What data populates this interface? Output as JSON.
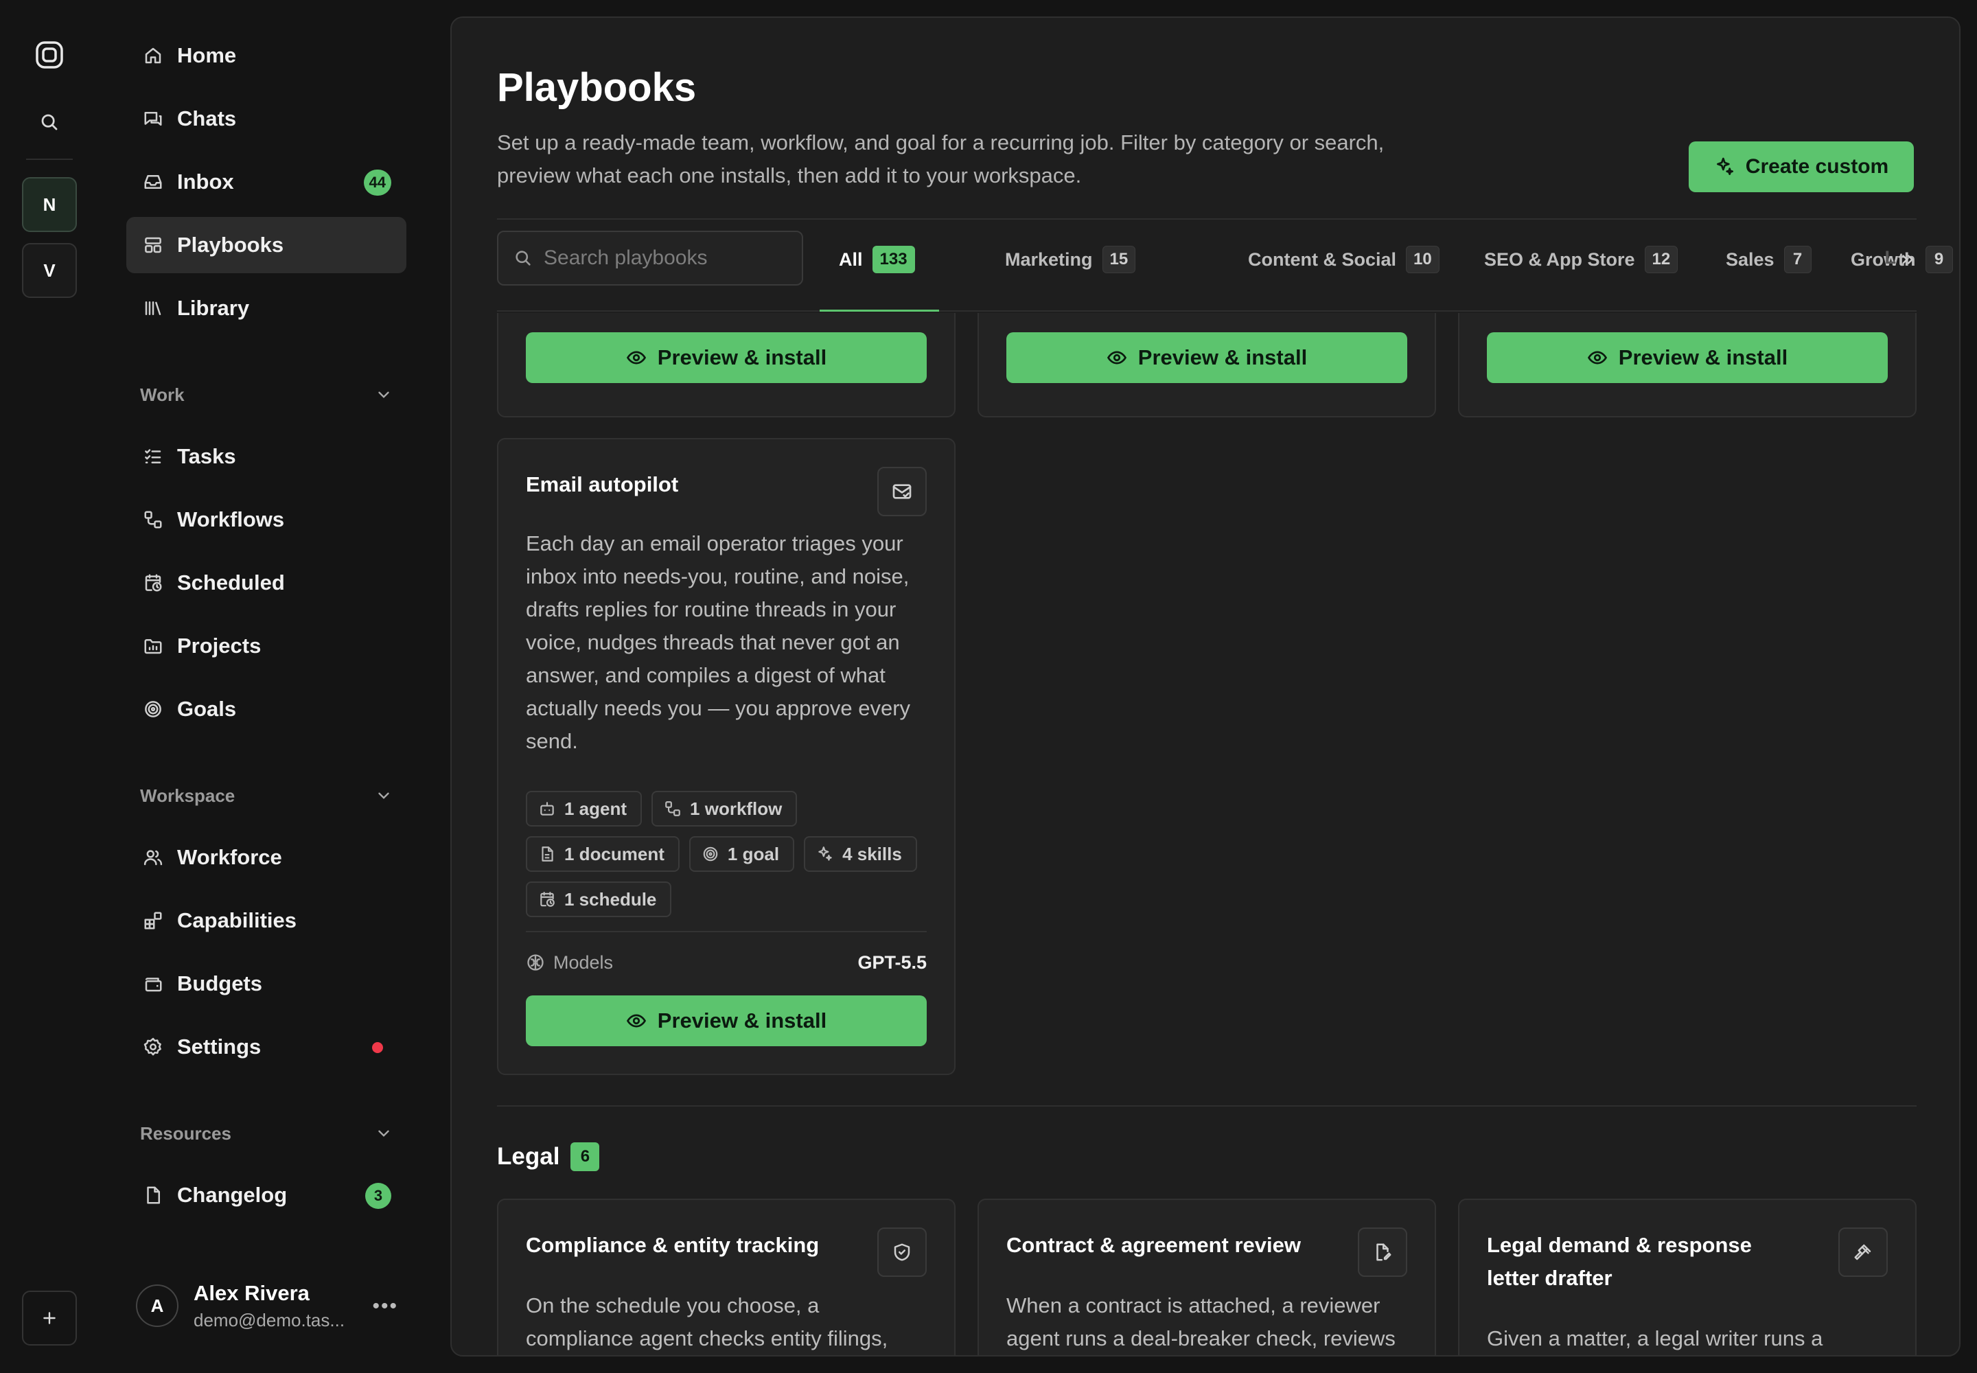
{
  "rail": {
    "workspaces": [
      {
        "letter": "N",
        "active": true
      },
      {
        "letter": "V",
        "active": false
      }
    ],
    "icons": {
      "logo": "logo-icon",
      "search": "search-icon",
      "add": "plus-icon"
    }
  },
  "sidebar": {
    "top_items": [
      {
        "label": "Home",
        "icon": "home-icon"
      },
      {
        "label": "Chats",
        "icon": "chat-icon"
      },
      {
        "label": "Inbox",
        "icon": "inbox-icon",
        "badge": "44"
      },
      {
        "label": "Playbooks",
        "icon": "grid-icon",
        "active": true
      },
      {
        "label": "Library",
        "icon": "library-icon"
      }
    ],
    "work": {
      "label": "Work",
      "items": [
        {
          "label": "Tasks",
          "icon": "tasks-icon"
        },
        {
          "label": "Workflows",
          "icon": "workflow-icon"
        },
        {
          "label": "Scheduled",
          "icon": "calendar-clock-icon"
        },
        {
          "label": "Projects",
          "icon": "folder-chart-icon"
        },
        {
          "label": "Goals",
          "icon": "target-icon"
        }
      ]
    },
    "workspace": {
      "label": "Workspace",
      "items": [
        {
          "label": "Workforce",
          "icon": "users-icon"
        },
        {
          "label": "Capabilities",
          "icon": "blocks-icon"
        },
        {
          "label": "Budgets",
          "icon": "wallet-icon"
        },
        {
          "label": "Settings",
          "icon": "gear-icon",
          "dot": true
        }
      ]
    },
    "resources": {
      "label": "Resources",
      "items": [
        {
          "label": "Changelog",
          "icon": "file-icon",
          "badge": "3"
        }
      ]
    },
    "user": {
      "initial": "A",
      "name": "Alex Rivera",
      "email": "demo@demo.tas..."
    }
  },
  "header": {
    "title": "Playbooks",
    "description": "Set up a ready-made team, workflow, and goal for a recurring job. Filter by category or search, preview what each one installs, then add it to your workspace.",
    "create_label": "Create custom"
  },
  "filters": {
    "search_placeholder": "Search playbooks",
    "tabs": [
      {
        "label": "All",
        "count": "133",
        "active": true
      },
      {
        "label": "Marketing",
        "count": "15"
      },
      {
        "label": "Content & Social",
        "count": "10"
      },
      {
        "label": "SEO & App Store",
        "count": "12"
      },
      {
        "label": "Sales",
        "count": "7"
      },
      {
        "label": "Growth",
        "count": "9"
      }
    ],
    "overflow_text": "L"
  },
  "install_label": "Preview & install",
  "email_card": {
    "title": "Email autopilot",
    "icon": "mail-check-icon",
    "description": "Each day an email operator triages your inbox into needs-you, routine, and noise, drafts replies for routine threads in your voice, nudges threads that never got an answer, and compiles a digest of what actually needs you — you approve every send.",
    "chips": [
      {
        "label": "1 agent",
        "icon": "bot-icon"
      },
      {
        "label": "1 workflow",
        "icon": "workflow-icon"
      },
      {
        "label": "1 document",
        "icon": "document-icon"
      },
      {
        "label": "1 goal",
        "icon": "target-icon"
      },
      {
        "label": "4 skills",
        "icon": "sparkles-icon"
      },
      {
        "label": "1 schedule",
        "icon": "calendar-clock-icon"
      }
    ],
    "models_label": "Models",
    "models_value": "GPT-5.5"
  },
  "legal": {
    "title": "Legal",
    "count": "6",
    "cards": [
      {
        "title": "Compliance & entity tracking",
        "icon": "shield-check-icon",
        "description": "On the schedule you choose, a compliance agent checks entity filings, renewal windows, and consents against"
      },
      {
        "title": "Contract & agreement review",
        "icon": "file-edit-icon",
        "description": "When a contract is attached, a reviewer agent runs a deal-breaker check, reviews each clause against your"
      },
      {
        "title": "Legal demand & response letter drafter",
        "icon": "gavel-icon",
        "description": "Given a matter, a legal writer runs a privilege and settlement-posture gate,"
      }
    ]
  },
  "colors": {
    "accent": "#5cc46e",
    "background": "#141414",
    "panel": "#1e1e1e",
    "card": "#232323",
    "alert_dot": "#f0394a"
  }
}
